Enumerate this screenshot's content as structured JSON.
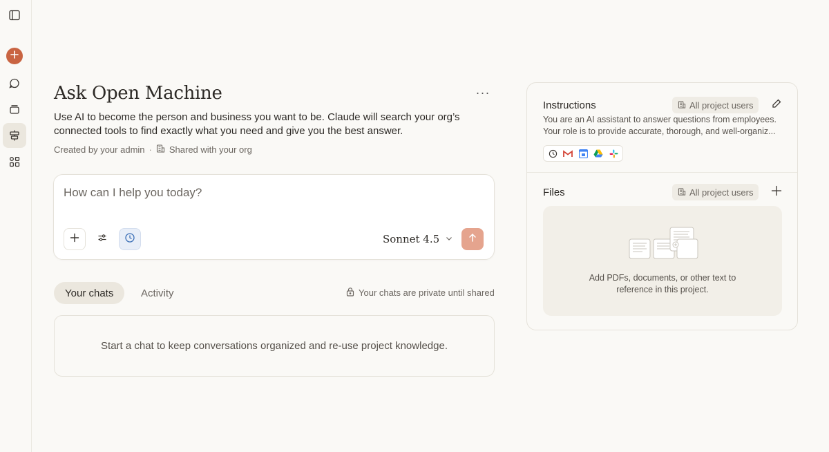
{
  "project": {
    "title": "Ask Open Machine",
    "description": "Use AI to become the person and business you want to be. Claude will search your org’s connected tools to find exactly what you need and give you the best answer.",
    "created_by": "Created by your admin",
    "separator": "·",
    "shared": "Shared with your org",
    "more_label": "···"
  },
  "composer": {
    "placeholder": "How can I help you today?",
    "model": "Sonnet 4.5"
  },
  "tabs": [
    {
      "label": "Your chats",
      "active": true
    },
    {
      "label": "Activity",
      "active": false
    }
  ],
  "private_note": "Your chats are private until shared",
  "empty_state": "Start a chat to keep conversations organized and re-use project knowledge.",
  "instructions": {
    "heading": "Instructions",
    "badge": "All project users",
    "text_line1": "You are an AI assistant to answer questions from employees.",
    "text_line2": "Your role is to provide accurate, thorough, and well-organiz...",
    "connectors": [
      "clock-icon",
      "gmail-icon",
      "calendar-icon",
      "drive-icon",
      "slack-icon"
    ]
  },
  "files": {
    "heading": "Files",
    "badge": "All project users",
    "hint_line1": "Add PDFs, documents, or other text to",
    "hint_line2": "reference in this project."
  },
  "sidebar": {
    "icons": [
      "sidebar-toggle-icon",
      "new-chat-icon",
      "chats-icon",
      "projects-icon",
      "artifacts-icon",
      "apps-icon"
    ]
  },
  "colors": {
    "accent": "#c96442",
    "send_disabled": "#e5a48e",
    "background": "#faf9f6"
  }
}
